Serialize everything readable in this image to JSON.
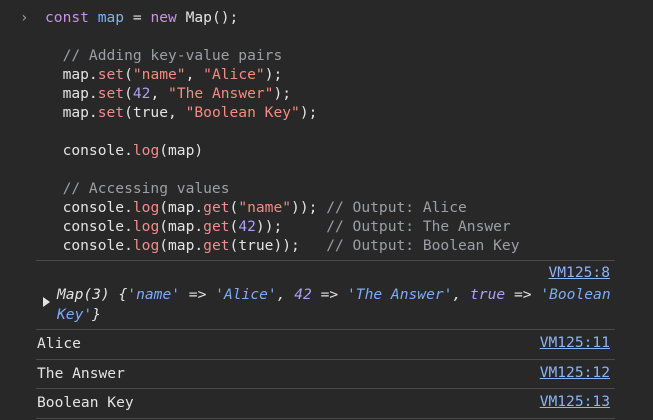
{
  "input": {
    "prompt": "›",
    "lines": [
      [
        {
          "t": "const",
          "c": "kw"
        },
        {
          "t": " ",
          "c": "plain"
        },
        {
          "t": "map",
          "c": "var"
        },
        {
          "t": " = ",
          "c": "plain"
        },
        {
          "t": "new",
          "c": "kw"
        },
        {
          "t": " Map();",
          "c": "plain"
        }
      ],
      [],
      [
        {
          "t": "  // Adding key-value pairs",
          "c": "cmt"
        }
      ],
      [
        {
          "t": "  map.",
          "c": "plain"
        },
        {
          "t": "set",
          "c": "meth"
        },
        {
          "t": "(",
          "c": "plain"
        },
        {
          "t": "\"name\"",
          "c": "str"
        },
        {
          "t": ", ",
          "c": "plain"
        },
        {
          "t": "\"Alice\"",
          "c": "str"
        },
        {
          "t": ");",
          "c": "plain"
        }
      ],
      [
        {
          "t": "  map.",
          "c": "plain"
        },
        {
          "t": "set",
          "c": "meth"
        },
        {
          "t": "(",
          "c": "plain"
        },
        {
          "t": "42",
          "c": "num"
        },
        {
          "t": ", ",
          "c": "plain"
        },
        {
          "t": "\"The Answer\"",
          "c": "str"
        },
        {
          "t": ");",
          "c": "plain"
        }
      ],
      [
        {
          "t": "  map.",
          "c": "plain"
        },
        {
          "t": "set",
          "c": "meth"
        },
        {
          "t": "(true, ",
          "c": "plain"
        },
        {
          "t": "\"Boolean Key\"",
          "c": "str"
        },
        {
          "t": ");",
          "c": "plain"
        }
      ],
      [],
      [
        {
          "t": "  console.",
          "c": "plain"
        },
        {
          "t": "log",
          "c": "meth"
        },
        {
          "t": "(map)",
          "c": "plain"
        }
      ],
      [],
      [
        {
          "t": "  // Accessing values",
          "c": "cmt"
        }
      ],
      [
        {
          "t": "  console.",
          "c": "plain"
        },
        {
          "t": "log",
          "c": "meth"
        },
        {
          "t": "(map.",
          "c": "plain"
        },
        {
          "t": "get",
          "c": "meth"
        },
        {
          "t": "(",
          "c": "plain"
        },
        {
          "t": "\"name\"",
          "c": "str"
        },
        {
          "t": ")); ",
          "c": "plain"
        },
        {
          "t": "// Output: Alice",
          "c": "cmt"
        }
      ],
      [
        {
          "t": "  console.",
          "c": "plain"
        },
        {
          "t": "log",
          "c": "meth"
        },
        {
          "t": "(map.",
          "c": "plain"
        },
        {
          "t": "get",
          "c": "meth"
        },
        {
          "t": "(",
          "c": "plain"
        },
        {
          "t": "42",
          "c": "num"
        },
        {
          "t": "));     ",
          "c": "plain"
        },
        {
          "t": "// Output: The Answer",
          "c": "cmt"
        }
      ],
      [
        {
          "t": "  console.",
          "c": "plain"
        },
        {
          "t": "log",
          "c": "meth"
        },
        {
          "t": "(map.",
          "c": "plain"
        },
        {
          "t": "get",
          "c": "meth"
        },
        {
          "t": "(true));   ",
          "c": "plain"
        },
        {
          "t": "// Output: Boolean Key",
          "c": "cmt"
        }
      ]
    ]
  },
  "map_entry": {
    "source": "VM125:8",
    "prefix": "Map(3) {",
    "k1": "'name'",
    "arrow1": " => ",
    "v1": "'Alice'",
    "sep1": ", ",
    "k2": "42",
    "arrow2": " => ",
    "v2": "'The Answer'",
    "sep2": ", ",
    "k3": "true",
    "arrow3": " => ",
    "v3": "'Boolean Key'",
    "suffix": "}"
  },
  "logs": [
    {
      "text": "Alice",
      "source": "VM125:11"
    },
    {
      "text": "The Answer",
      "source": "VM125:12"
    },
    {
      "text": "Boolean Key",
      "source": "VM125:13"
    }
  ],
  "colors": {
    "background": "#282828",
    "link": "#8ab4f8",
    "keyword": "#c792ea",
    "string": "#f28b82",
    "number": "#ae9ff8"
  }
}
